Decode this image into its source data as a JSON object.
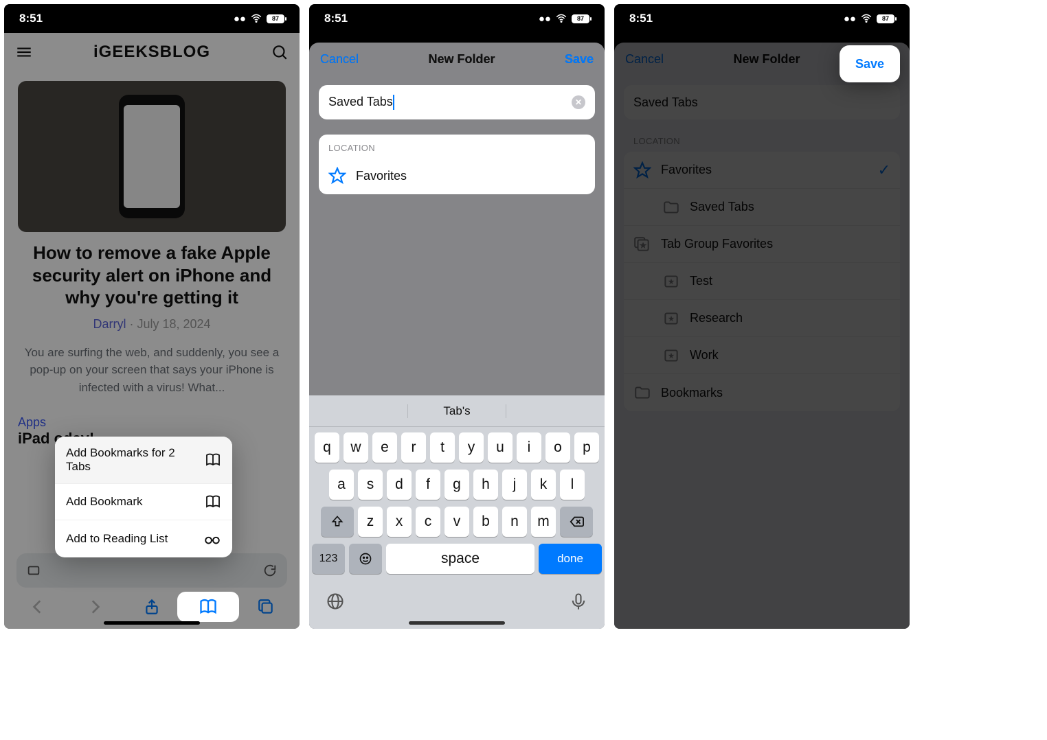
{
  "status": {
    "time": "8:51",
    "battery": "87"
  },
  "panel1": {
    "logo": "iGEEKSBLOG",
    "article_title": "How to remove a fake Apple security alert on iPhone and why you're getting it",
    "author": "Darryl",
    "sep": " · ",
    "date": "July 18, 2024",
    "excerpt": "You are surfing the web, and suddenly, you see a pop-up on your screen that says your iPhone is infected with a virus! What...",
    "apps_label": "Apps",
    "apps_line": "iPad                                             oday!",
    "menu": {
      "item1": "Add Bookmarks for 2 Tabs",
      "item2": "Add Bookmark",
      "item3": "Add to Reading List"
    }
  },
  "newfolder": {
    "cancel": "Cancel",
    "title": "New Folder",
    "save": "Save",
    "name_value": "Saved Tabs",
    "location_label": "LOCATION",
    "favorites": "Favorites"
  },
  "panel3": {
    "items": {
      "favorites": "Favorites",
      "saved_tabs": "Saved Tabs",
      "tgf": "Tab Group Favorites",
      "test": "Test",
      "research": "Research",
      "work": "Work",
      "bookmarks": "Bookmarks"
    }
  },
  "keyboard": {
    "suggestion": "Tab's",
    "row1": [
      "q",
      "w",
      "e",
      "r",
      "t",
      "y",
      "u",
      "i",
      "o",
      "p"
    ],
    "row2": [
      "a",
      "s",
      "d",
      "f",
      "g",
      "h",
      "j",
      "k",
      "l"
    ],
    "row3": [
      "z",
      "x",
      "c",
      "v",
      "b",
      "n",
      "m"
    ],
    "numeric": "123",
    "space": "space",
    "done": "done"
  }
}
